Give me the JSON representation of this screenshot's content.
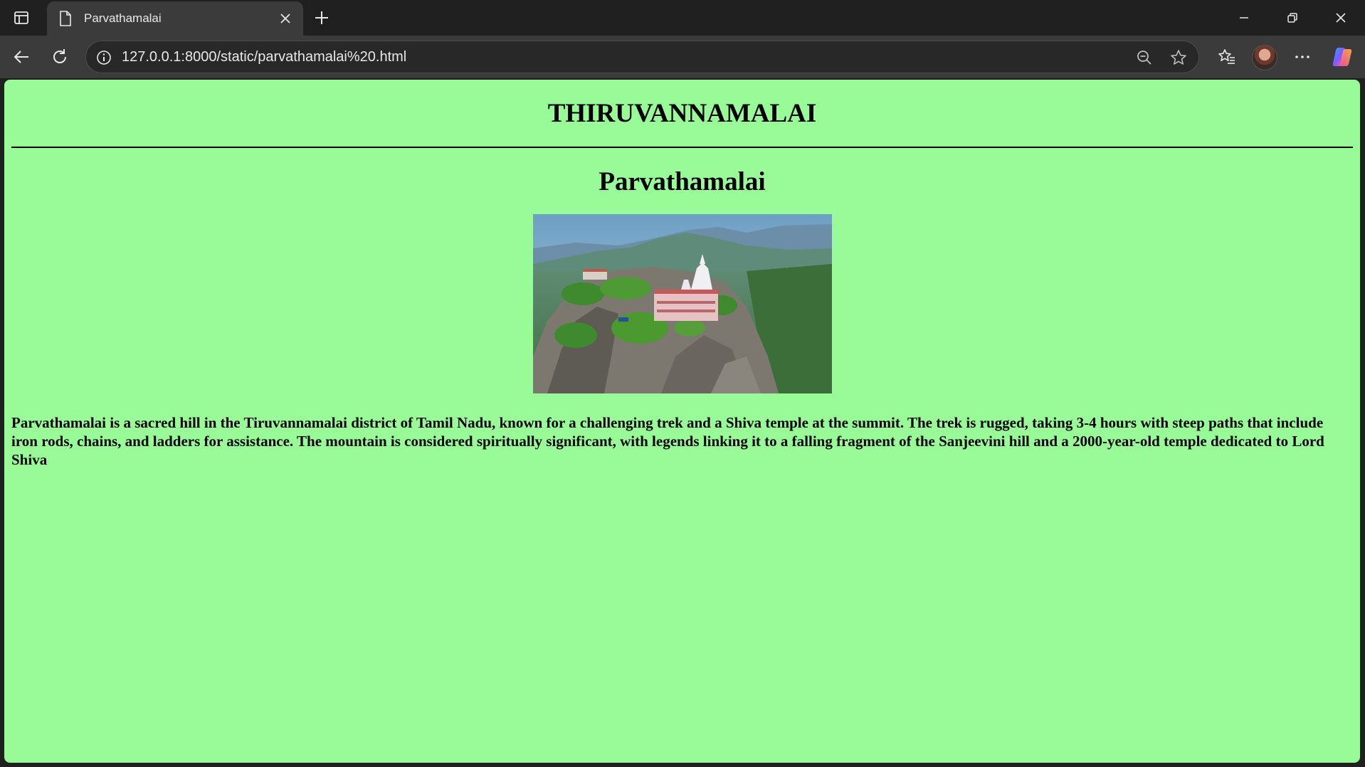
{
  "browser": {
    "tab": {
      "title": "Parvathamalai",
      "icon": "document-icon"
    },
    "address_bar": {
      "url": "127.0.0.1:8000/static/parvathamalai%20.html"
    },
    "colors": {
      "chrome_bg": "#202020",
      "toolbar_bg": "#3b3b3b",
      "text": "#e8e8e8"
    }
  },
  "page": {
    "background": "#98fb98",
    "site_heading": "THIRUVANNAMALAI",
    "title": "Parvathamalai",
    "image": {
      "subject": "hilltop temple on a rocky mountain peak",
      "icon": "landscape-photo"
    },
    "description": "Parvathamalai is a sacred hill in the Tiruvannamalai district of Tamil Nadu, known for a challenging trek and a Shiva temple at the summit. The trek is rugged, taking 3-4 hours with steep paths that include iron rods, chains, and ladders for assistance. The mountain is considered spiritually significant, with legends linking it to a falling fragment of the Sanjeevini hill and a 2000-year-old temple dedicated to Lord Shiva"
  }
}
